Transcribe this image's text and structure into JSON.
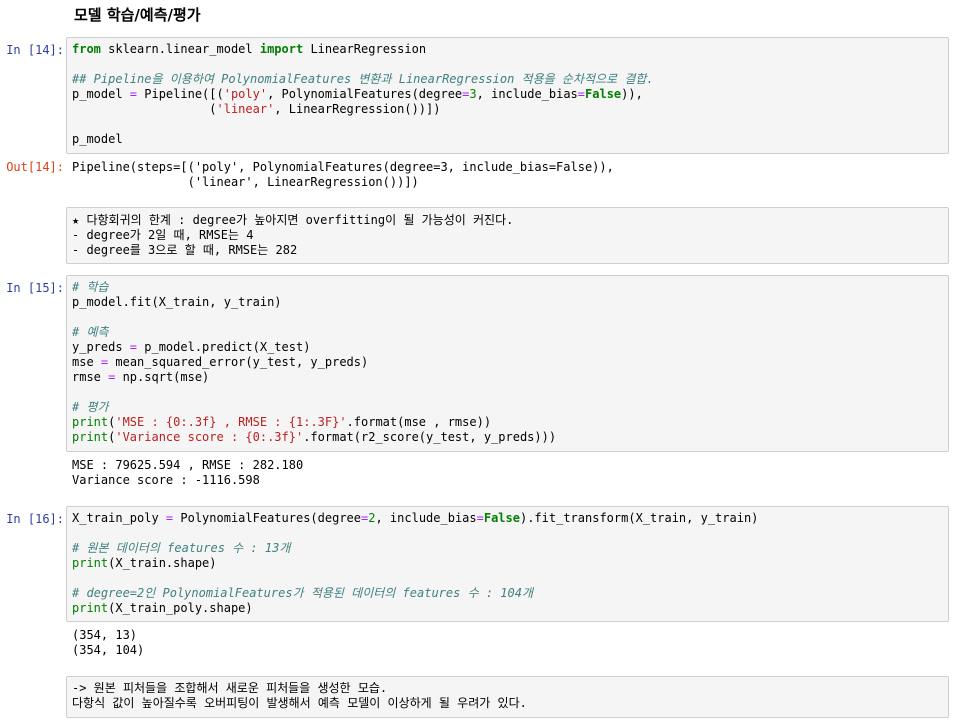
{
  "title": "모델 학습/예측/평가",
  "cell14": {
    "in_prompt": "In [14]:",
    "line1_from": "from",
    "line1_mod": " sklearn.linear_model ",
    "line1_import": "import",
    "line1_rest": " LinearRegression",
    "comment": "## Pipeline을 이용하여 PolynomialFeatures 변환과 LinearRegression 적용을 순차적으로 결합.",
    "p1": "p_model ",
    "eq": "=",
    "p2": " Pipeline([(",
    "poly_str": "'poly'",
    "p3": ", PolynomialFeatures(degree",
    "deg3": "3",
    "p4": ", include_bias",
    "false_kw": "False",
    "p5": ")),",
    "indent": "                   (",
    "linear_str": "'linear'",
    "p6": ", LinearRegression())])",
    "last": "p_model",
    "out_prompt": "Out[14]:",
    "out1": "Pipeline(steps=[('poly', PolynomialFeatures(degree=3, include_bias=False)),",
    "out2": "                ('linear', LinearRegression())])"
  },
  "md1": {
    "line1": "★ 다항회귀의 한계 : degree가 높아지면 overfitting이 될 가능성이 커진다.",
    "line2": "- degree가 2일 때, RMSE는 4",
    "line3": "- degree를 3으로 할 때, RMSE는 282"
  },
  "cell15": {
    "in_prompt": "In [15]:",
    "c1": "# 학습",
    "fit": "p_model.fit(X_train, y_train)",
    "c2": "# 예측",
    "y1": "y_preds ",
    "y2": " p_model.predict(X_test)",
    "m1": "mse ",
    "m2": " mean_squared_error(y_test, y_preds)",
    "r1": "rmse ",
    "r2": " np.sqrt(mse)",
    "c3": "# 평가",
    "print": "print",
    "s1": "'MSE : {0:.3f} , RMSE : {1:.3F}'",
    "f1": ".format(mse , rmse))",
    "s2": "'Variance score : {0:.3f}'",
    "f2": ".format(r2_score(y_test, y_preds)))",
    "out1": "MSE : 79625.594 , RMSE : 282.180",
    "out2": "Variance score : -1116.598"
  },
  "cell16": {
    "in_prompt": "In [16]:",
    "a1": "X_train_poly ",
    "a2": " PolynomialFeatures(degree",
    "deg2": "2",
    "a3": ", include_bias",
    "false_kw": "False",
    "a4": ").fit_transform(X_train, y_train)",
    "c1": "# 원본 데이터의 features 수 : 13개",
    "print": "print",
    "pr1": "(X_train.shape)",
    "c2": "# degree=2인 PolynomialFeatures가 적용된 데이터의 features 수 : 104개",
    "pr2": "(X_train_poly.shape)",
    "out1": "(354, 13)",
    "out2": "(354, 104)"
  },
  "md2": {
    "line1": "-> 원본 피처들을 조합해서 새로운 피처들을 생성한 모습.",
    "line2": "다항식 값이 높아질수록 오버피팅이 발생해서 예측 모델이 이상하게 될 우려가 있다."
  }
}
